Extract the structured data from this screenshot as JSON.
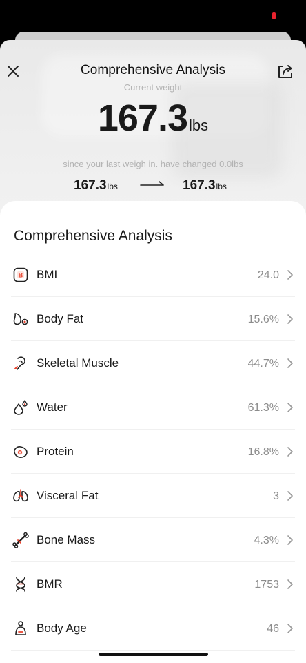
{
  "header": {
    "title": "Comprehensive Analysis",
    "subtitle": "Current weight"
  },
  "weight": {
    "value": "167.3",
    "unit": "lbs",
    "change_text": "since your last weigh in. have changed 0.0lbs",
    "from_value": "167.3",
    "from_unit": "lbs",
    "to_value": "167.3",
    "to_unit": "lbs"
  },
  "analysis": {
    "title": "Comprehensive Analysis",
    "items": [
      {
        "label": "BMI",
        "value": "24.0",
        "icon": "bmi-icon"
      },
      {
        "label": "Body Fat",
        "value": "15.6%",
        "icon": "body-fat-icon"
      },
      {
        "label": "Skeletal Muscle",
        "value": "44.7%",
        "icon": "skeletal-muscle-icon"
      },
      {
        "label": "Water",
        "value": "61.3%",
        "icon": "water-icon"
      },
      {
        "label": "Protein",
        "value": "16.8%",
        "icon": "protein-icon"
      },
      {
        "label": "Visceral Fat",
        "value": "3",
        "icon": "visceral-fat-icon"
      },
      {
        "label": "Bone Mass",
        "value": "4.3%",
        "icon": "bone-mass-icon"
      },
      {
        "label": "BMR",
        "value": "1753",
        "icon": "bmr-icon"
      },
      {
        "label": "Body Age",
        "value": "46",
        "icon": "body-age-icon"
      }
    ]
  },
  "colors": {
    "accent": "#e8412c",
    "text": "#1a1a1a",
    "muted": "#8c8c8c"
  }
}
